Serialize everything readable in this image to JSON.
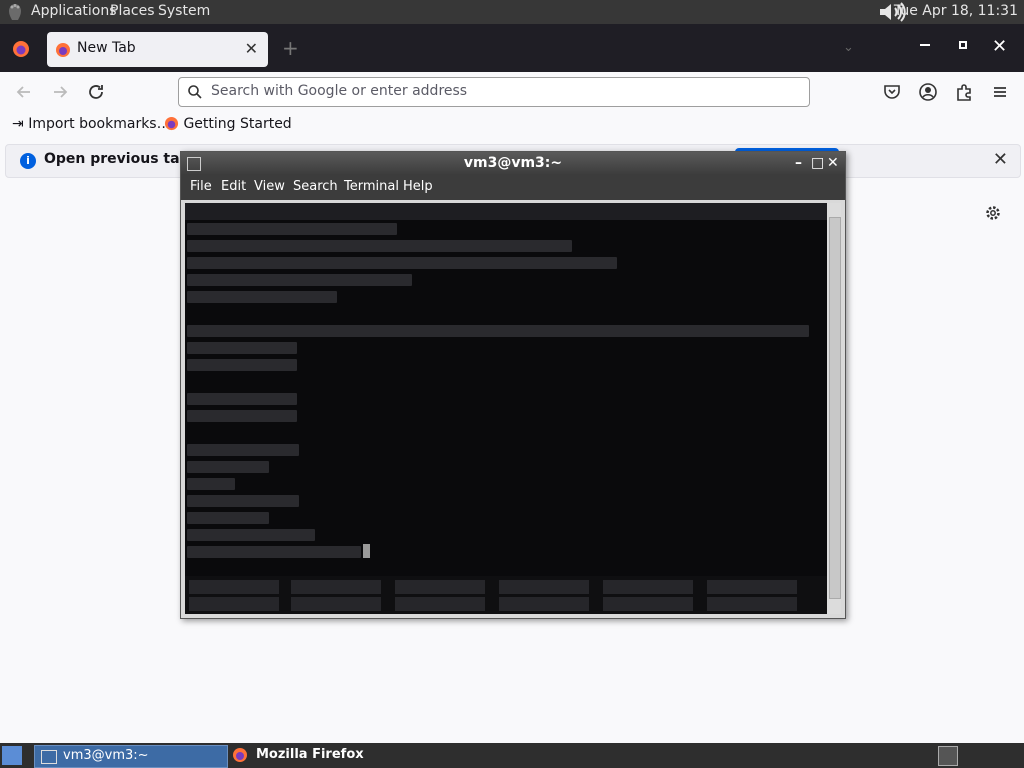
{
  "top_panel": {
    "menus": [
      "Applications",
      "Places",
      "System"
    ],
    "clock": "Tue Apr 18, 11:31"
  },
  "browser": {
    "tab_title": "New Tab",
    "url_placeholder": "Search with Google or enter address",
    "bookmarks": [
      "Import bookmarks…",
      "Getting Started"
    ],
    "notification": "Open previous tabs?"
  },
  "terminal": {
    "title": "vm3@vm3:~",
    "menus": [
      "File",
      "Edit",
      "View",
      "Search",
      "Terminal",
      "Help"
    ]
  },
  "taskbar": {
    "items": [
      "vm3@vm3:~",
      "Mozilla Firefox"
    ]
  },
  "colors": {
    "panel": "#373737",
    "firefox_dark": "#1f1e25",
    "accent": "#0061e0",
    "terminal_bg": "#0a0a0c"
  }
}
